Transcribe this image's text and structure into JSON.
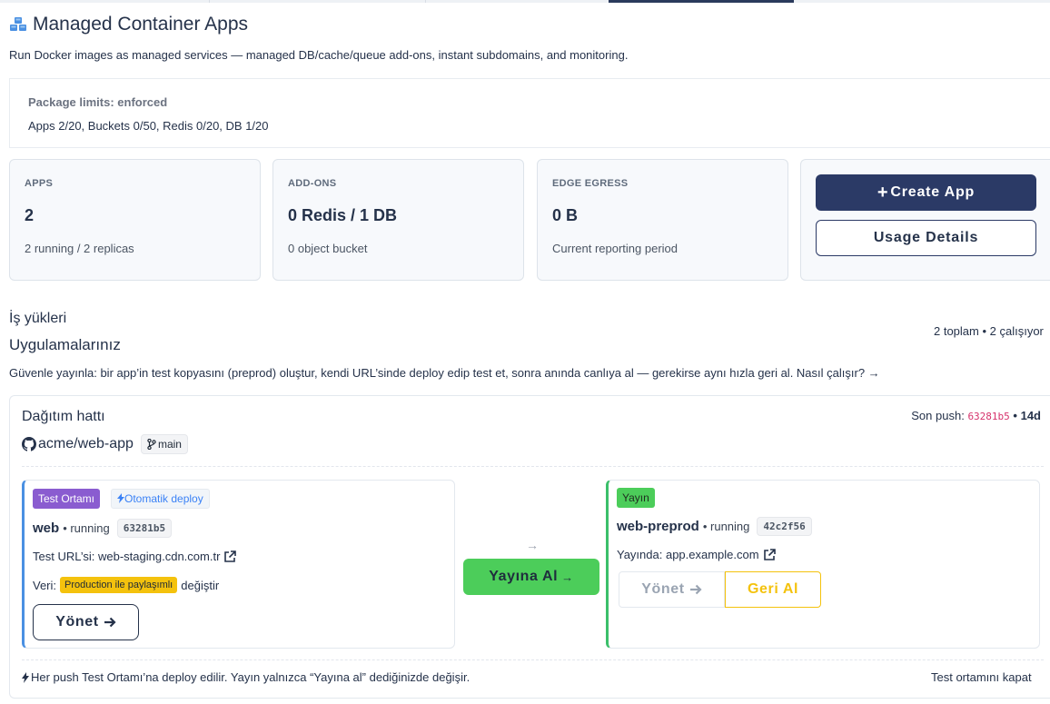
{
  "header": {
    "title": "Managed Container Apps",
    "subtitle": "Run Docker images as managed services — managed DB/cache/queue add-ons, instant subdomains, and monitoring."
  },
  "limits": {
    "heading": "Package limits: enforced",
    "values": "Apps 2/20, Buckets 0/50, Redis 0/20, DB 1/20"
  },
  "stats": [
    {
      "label": "APPS",
      "value": "2",
      "sub": "2 running / 2 replicas"
    },
    {
      "label": "ADD-ONS",
      "value": "0 Redis / 1 DB",
      "sub": "0 object bucket"
    },
    {
      "label": "EDGE EGRESS",
      "value": "0 B",
      "sub": "Current reporting period"
    }
  ],
  "actions": {
    "create": "Create App",
    "usage": "Usage Details"
  },
  "section": {
    "overline": "İş yükleri",
    "title": "Uygulamalarınız",
    "count": "2 toplam • 2 çalışıyor",
    "description": "Güvenle yayınla: bir app’in test kopyasını (preprod) oluştur, kendi URL’sinde deploy edip test et, sonra anında canlıya al — gerekirse aynı hızla geri al. Nasıl çalışır? →"
  },
  "pipeline": {
    "title": "Dağıtım hattı",
    "push_label": "Son push:",
    "push_hash": "63281b5",
    "push_age": "• 14d",
    "repo": "acme/web-app",
    "branch": "main",
    "staging": {
      "tag": "Test Ortamı",
      "auto": "Otomatik deploy",
      "name": "web",
      "status": "• running",
      "commit": "63281b5",
      "url": "Test URL’si: web-staging.cdn.com.tr",
      "data_label": "Veri:",
      "data_badge": "Production ile paylaşımlı",
      "data_change": "değiştir",
      "manage": "Yönet"
    },
    "flow_arrow": "→",
    "deploy": "Yayına Al",
    "production": {
      "tag": "Yayın",
      "name": "web-preprod",
      "status": "• running",
      "commit": "42c2f56",
      "url": "Yayında: app.example.com",
      "manage": "Yönet",
      "rollback": "Geri Al"
    },
    "footer": "Her push Test Ortamı’na deploy edilir. Yayın yalnızca “Yayına al” dediğinizde değişir.",
    "close": "Test ortamını kapat"
  },
  "colors": {
    "primary": "#2b3a66",
    "staging_accent": "#4a90e2",
    "prod_accent": "#3bbf6a",
    "deploy_green": "#4ccd5a",
    "warning": "#f4c20d",
    "purple_tag": "#8a5cd0"
  },
  "icons": {
    "title": "cubes-icon",
    "repo": "github-icon",
    "branch": "git-branch-icon",
    "auto": "lightning-icon",
    "external": "external-link-icon",
    "create": "plus-icon",
    "arrow": "arrow-right-icon",
    "footer": "lightning-icon"
  }
}
